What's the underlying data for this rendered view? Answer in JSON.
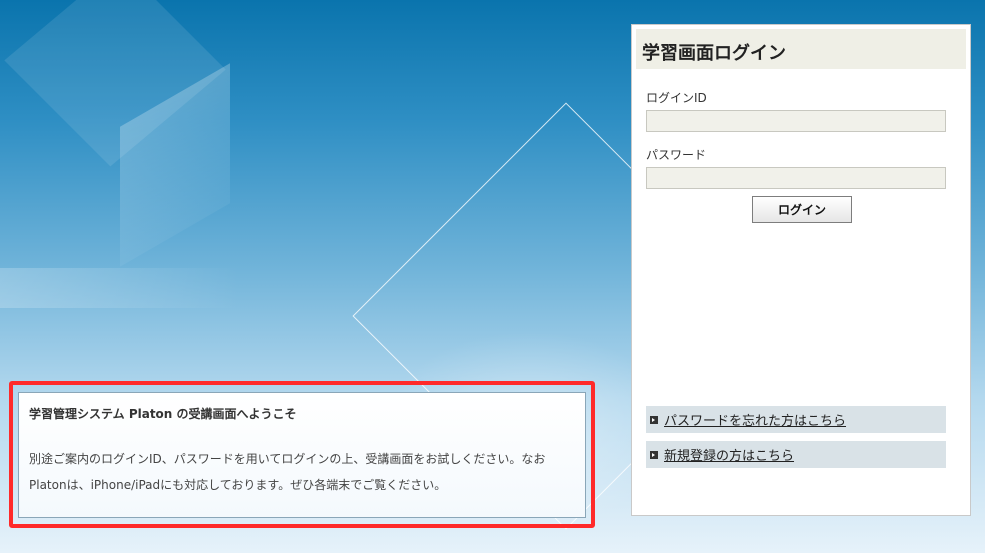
{
  "welcome": {
    "title": "学習管理システム Platon の受講画面へようこそ",
    "text": "別途ご案内のログインID、パスワードを用いてログインの上、受講画面をお試しください。なおPlatonは、iPhone/iPadにも対応しております。ぜひ各端末でご覧ください。"
  },
  "login": {
    "title": "学習画面ログイン",
    "id_label": "ログインID",
    "id_value": "",
    "password_label": "パスワード",
    "password_value": "",
    "button_label": "ログイン",
    "links": {
      "forgot_password": "パスワードを忘れた方はこちら",
      "register": "新規登録の方はこちら"
    }
  },
  "colors": {
    "highlight": "#ff2a2a",
    "background_top": "#0a74ad"
  }
}
